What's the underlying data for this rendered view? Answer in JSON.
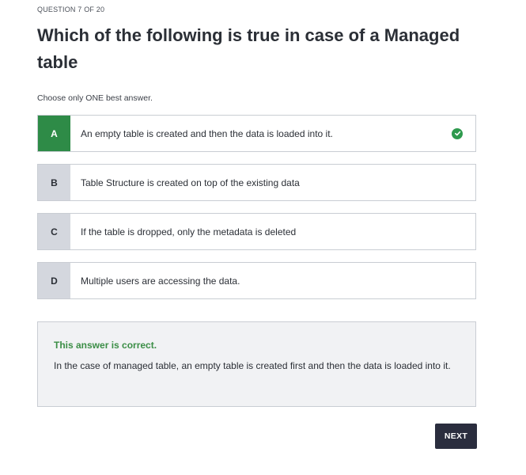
{
  "quiz": {
    "counter": "QUESTION 7 OF 20",
    "question": "Which of the following is true in case of a Managed table",
    "instruction": "Choose only ONE best answer.",
    "options": [
      {
        "letter": "A",
        "text": "An empty table is created and then the data is loaded into it.",
        "correct": true
      },
      {
        "letter": "B",
        "text": "Table Structure is created on top of the existing data",
        "correct": false
      },
      {
        "letter": "C",
        "text": "If the table is dropped, only the metadata is deleted",
        "correct": false
      },
      {
        "letter": "D",
        "text": "Multiple users are accessing the data.",
        "correct": false
      }
    ],
    "feedback": {
      "title": "This answer is correct.",
      "text": "In the case of managed table, an empty table is created first and then the data is loaded into it."
    },
    "next_label": "NEXT"
  },
  "icons": {
    "selected_check": "check-circle-icon"
  },
  "colors": {
    "correct_green": "#2e8b47",
    "check_green": "#2e9a4e",
    "feedback_title_green": "#3b8e46",
    "letter_gray": "#d4d7de",
    "next_button": "#2a2d3e"
  }
}
